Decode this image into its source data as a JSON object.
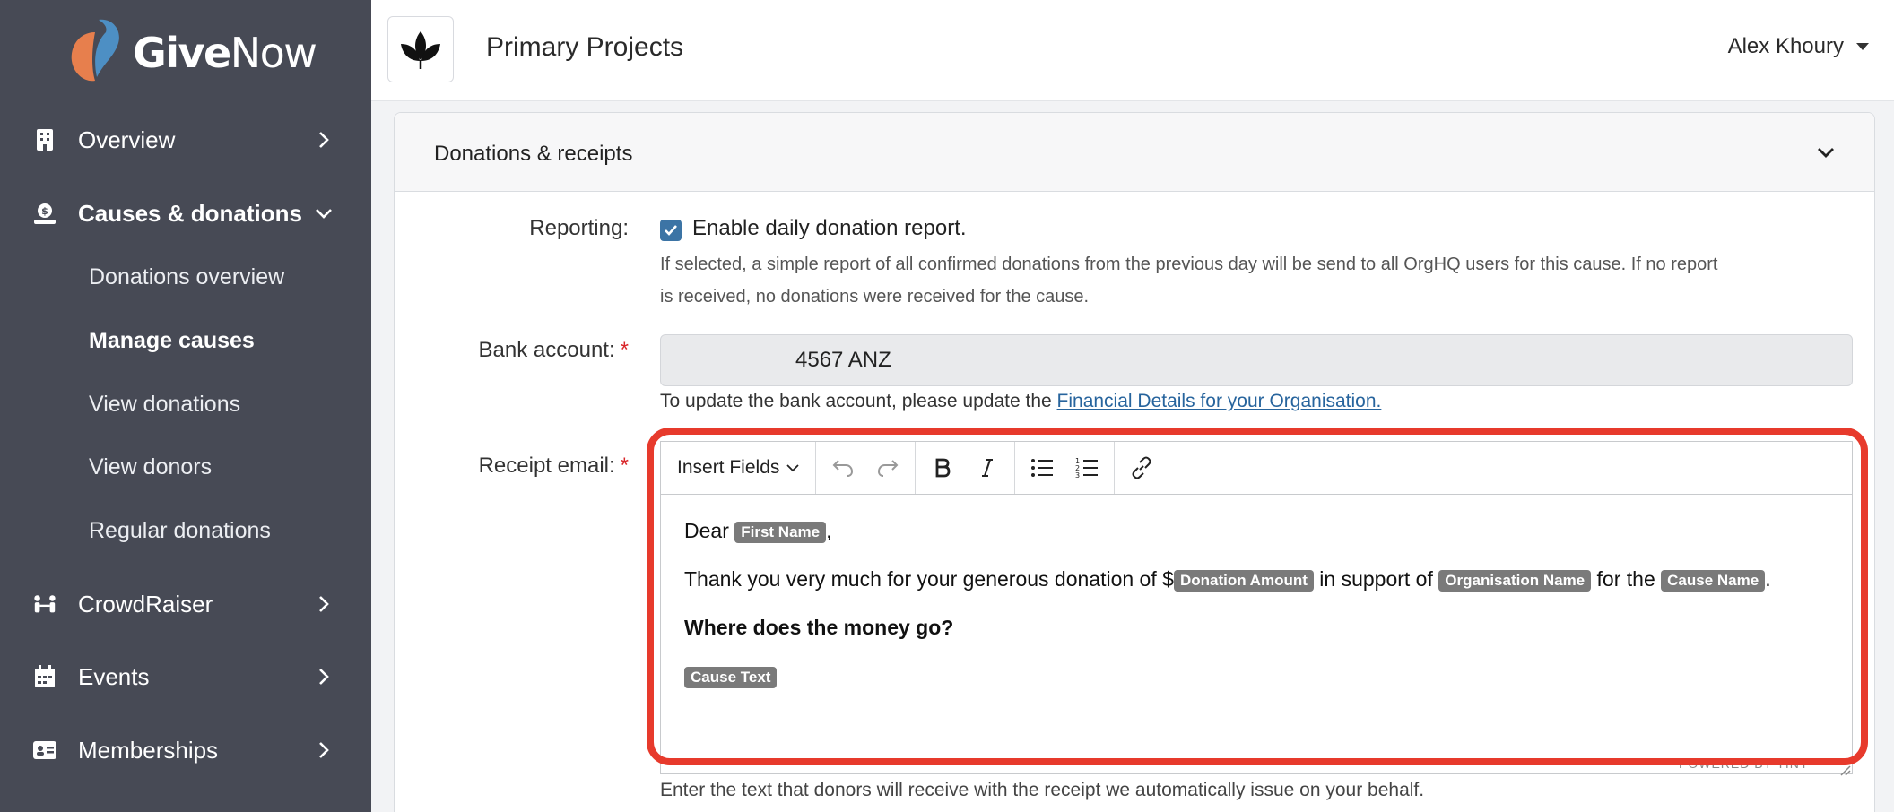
{
  "brand": {
    "name_bold": "Give",
    "name_regular": "Now"
  },
  "sidebar": {
    "items": [
      {
        "label": "Overview",
        "icon": "building-icon"
      },
      {
        "label": "Causes & donations",
        "icon": "donation-icon",
        "expanded": true
      },
      {
        "label": "CrowdRaiser",
        "icon": "people-icon"
      },
      {
        "label": "Events",
        "icon": "calendar-icon"
      },
      {
        "label": "Memberships",
        "icon": "id-card-icon"
      }
    ],
    "subitems": [
      {
        "label": "Donations overview"
      },
      {
        "label": "Manage causes",
        "active": true
      },
      {
        "label": "View donations"
      },
      {
        "label": "View donors"
      },
      {
        "label": "Regular donations"
      }
    ]
  },
  "header": {
    "org_title": "Primary Projects",
    "user_name": "Alex Khoury"
  },
  "section": {
    "title": "Donations & receipts",
    "reporting": {
      "label": "Reporting:",
      "checkbox_label": "Enable daily donation report.",
      "checked": true,
      "help_line1": "If selected, a simple report of all confirmed donations from the previous day will be send to all OrgHQ users for this cause. If no report",
      "help_line2": "is received, no donations were received for the cause."
    },
    "bank": {
      "label": "Bank account:",
      "required_mark": "*",
      "value": "4567 ANZ",
      "help_prefix": "To update the bank account, please update the",
      "help_link": "Financial Details for your Organisation."
    },
    "receipt": {
      "label": "Receipt email:",
      "required_mark": "*",
      "toolbar": {
        "insert_fields": "Insert Fields"
      },
      "body": {
        "dear": "Dear",
        "first_name_tag": "First Name",
        "comma": ",",
        "thanks_prefix": "Thank you very much for your generous donation of $",
        "donation_amount_tag": "Donation Amount",
        "in_support_of": "in support of",
        "organisation_name_tag": "Organisation Name",
        "for_the": "for the",
        "cause_name_tag": "Cause Name",
        "period": ".",
        "heading": "Where does the money go?",
        "cause_text_tag": "Cause Text"
      },
      "powered_by": "POWERED BY TINY",
      "help": "Enter the text that donors will receive with the receipt we automatically issue on your behalf."
    }
  },
  "colors": {
    "sidebar_bg": "#474a55",
    "highlight": "#e73a2c",
    "checkbox": "#3c74a5",
    "link": "#27649d"
  }
}
